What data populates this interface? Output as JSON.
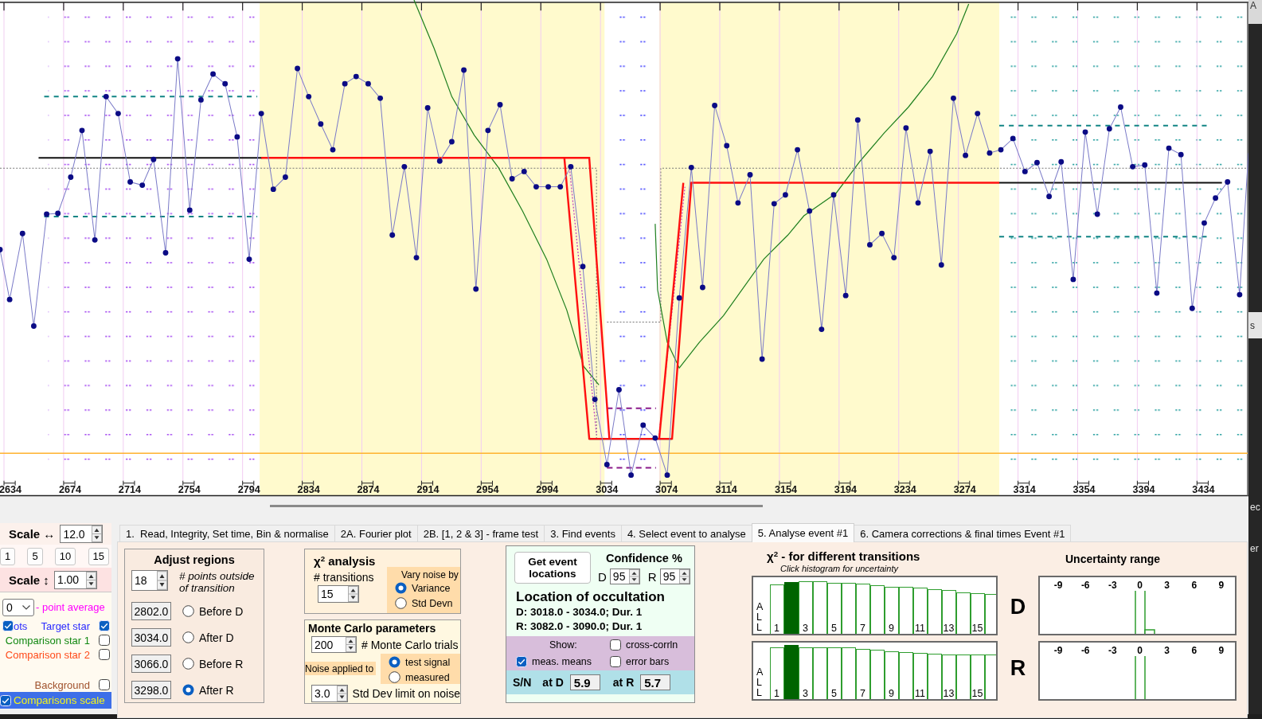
{
  "chart": {
    "x_tick_labels": [
      "2634",
      "2674",
      "2714",
      "2754",
      "2794",
      "2834",
      "2874",
      "2914",
      "2954",
      "2994",
      "3034",
      "3074",
      "3114",
      "3154",
      "3194",
      "3234",
      "3274",
      "3314",
      "3354",
      "3394",
      "3434"
    ]
  },
  "background_window": {
    "text_fragments": [
      "A",
      "s",
      "ec",
      "er"
    ]
  },
  "left_panel": {
    "horizontal_scale": {
      "label": "Scale ↔",
      "value": "12.0"
    },
    "scale_buttons": [
      "1",
      "5",
      "10",
      "15"
    ],
    "vertical_scale": {
      "label": "Scale ↕",
      "value": "1.00"
    },
    "point_average": {
      "value": "0",
      "label": "- point average"
    },
    "plots_toggle": {
      "label": "ots",
      "checked": true
    },
    "series": [
      {
        "label": "Target star",
        "checked": true,
        "color": "#2a2aff"
      },
      {
        "label": "Comparison star 1",
        "checked": false,
        "color": "#118811"
      },
      {
        "label": "Comparison star 2",
        "checked": false,
        "color": "#ff4a1a"
      },
      {
        "label": "Background",
        "checked": false,
        "color": "#a0522d"
      }
    ],
    "comparisons_scaled": {
      "label": "Comparisons scale",
      "checked": true
    }
  },
  "tabs": [
    {
      "label": "1.  Read, Integrity, Set time, Bin & normalise",
      "selected": false
    },
    {
      "label": "2A. Fourier plot",
      "selected": false
    },
    {
      "label": "2B. [1, 2 & 3] - frame test",
      "selected": false
    },
    {
      "label": "3. Find events",
      "selected": false
    },
    {
      "label": "4. Select event to analyse",
      "selected": false
    },
    {
      "label": "5. Analyse event #1",
      "selected": true
    },
    {
      "label": "6. Camera corrections & final times Event #1",
      "selected": false
    }
  ],
  "adjust_regions": {
    "title": "Adjust regions",
    "points_outside": {
      "value": "18",
      "label": "# points outside of transition"
    },
    "regions": [
      {
        "value": "2802.0",
        "label": "Before D",
        "selected": false
      },
      {
        "value": "3034.0",
        "label": "After D",
        "selected": false
      },
      {
        "value": "3066.0",
        "label": "Before R",
        "selected": false
      },
      {
        "value": "3298.0",
        "label": "After R",
        "selected": true
      }
    ]
  },
  "chi2_analysis": {
    "title": "χ$^{2}$ analysis",
    "transitions": {
      "label": "# transitions",
      "value": "15"
    },
    "vary_noise": {
      "label": "Vary noise by",
      "options": [
        {
          "label": "Variance",
          "selected": true
        },
        {
          "label": "Std Devn",
          "selected": false
        }
      ]
    }
  },
  "monte_carlo": {
    "title": "Monte Carlo parameters",
    "trials": {
      "value": "200",
      "label": "# Monte Carlo trials"
    },
    "noise_applied": {
      "label": "Noise applied to",
      "options": [
        {
          "label": "test signal",
          "selected": true
        },
        {
          "label": "measured",
          "selected": false
        }
      ]
    },
    "std_dev_limit": {
      "value": "3.0",
      "label": "Std Dev limit on noise"
    }
  },
  "location": {
    "button": "Get event locations",
    "confidence": {
      "title": "Confidence %",
      "d": {
        "label": "D",
        "value": "95"
      },
      "r": {
        "label": "R",
        "value": "95"
      }
    },
    "title": "Location of occultation",
    "lines": [
      "D: 3018.0 - 3034.0; Dur. 1",
      "R: 3082.0 - 3090.0; Dur. 1"
    ],
    "show": {
      "label": "Show:",
      "options": [
        {
          "label": "cross-corrln",
          "checked": false
        },
        {
          "label": "meas. means",
          "checked": true
        },
        {
          "label": "error bars",
          "checked": false
        }
      ]
    },
    "signal_to_noise": {
      "label": "S/N",
      "d": {
        "label": "at D",
        "value": "5.9"
      },
      "r": {
        "label": "at R",
        "value": "5.7"
      }
    }
  },
  "transition_histograms": {
    "title": "χ$^{2}$ - for different transitions",
    "hint": "Click histogram for uncertainty",
    "plots": [
      {
        "label": "D",
        "all_label": "ALL",
        "bars": [
          {
            "label": "1",
            "selected": false
          },
          {
            "selected": true
          },
          {
            "label": "3",
            "selected": false
          },
          {
            "selected": false
          },
          {
            "label": "5",
            "selected": false
          },
          {
            "selected": false
          },
          {
            "label": "7",
            "selected": false
          },
          {
            "selected": false
          },
          {
            "label": "9",
            "selected": false
          },
          {
            "selected": false
          },
          {
            "label": "11",
            "selected": false
          },
          {
            "selected": false
          },
          {
            "label": "13",
            "selected": false
          },
          {
            "selected": false
          },
          {
            "label": "15",
            "selected": false
          },
          {
            "selected": false
          }
        ]
      },
      {
        "label": "R",
        "all_label": "ALL",
        "bars": [
          {
            "label": "1",
            "selected": false
          },
          {
            "selected": true
          },
          {
            "label": "3",
            "selected": false
          },
          {
            "selected": false
          },
          {
            "label": "5",
            "selected": false
          },
          {
            "selected": false
          },
          {
            "label": "7",
            "selected": false
          },
          {
            "selected": false
          },
          {
            "label": "9",
            "selected": false
          },
          {
            "selected": false
          },
          {
            "label": "11",
            "selected": false
          },
          {
            "selected": false
          },
          {
            "label": "13",
            "selected": false
          },
          {
            "selected": false
          },
          {
            "label": "15",
            "selected": false
          },
          {
            "selected": false
          }
        ]
      }
    ]
  },
  "uncertainty": {
    "title": "Uncertainty range",
    "plots": [
      {
        "tick_labels": [
          "-9",
          "-6",
          "-3",
          "0",
          "3",
          "6",
          "9"
        ]
      },
      {
        "tick_labels": [
          "-9",
          "-6",
          "-3",
          "0",
          "3",
          "6",
          "9"
        ]
      }
    ]
  }
}
